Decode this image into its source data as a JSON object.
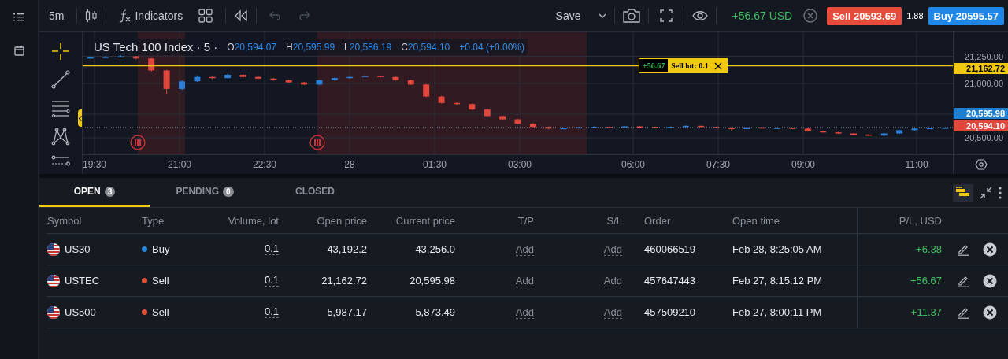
{
  "toolbar": {
    "timeframe": "5m",
    "indicators": "Indicators",
    "save": "Save",
    "pnl": "+56.67 USD",
    "sell": "Sell 20593.69",
    "spread": "1.88",
    "buy": "Buy 20595.57"
  },
  "chart": {
    "title": "US Tech 100 Index · 5 ·",
    "ohlc": [
      {
        "key": "O",
        "value": "20,594.07"
      },
      {
        "key": "H",
        "value": "20,595.99"
      },
      {
        "key": "L",
        "value": "20,586.19"
      },
      {
        "key": "C",
        "value": "20,594.10"
      }
    ],
    "change": "+0.04 (+0.00%)",
    "order_badge": {
      "pnl": "+56.67",
      "label": "Sell lot: 0.1"
    },
    "time_labels": [
      "19:30",
      "21:00",
      "22:30",
      "28",
      "01:30",
      "03:00",
      "06:00",
      "07:30",
      "09:00",
      "11:00"
    ],
    "tags": [
      {
        "kind": "order",
        "text": "21,162.72"
      },
      {
        "kind": "ask",
        "text": "20,595.98"
      },
      {
        "kind": "bid",
        "text": "20,594.10"
      }
    ],
    "chart_data": {
      "type": "candlestick",
      "categories": [
        null,
        null,
        null,
        null,
        null,
        null,
        null,
        null,
        null,
        null,
        null,
        null,
        null,
        null,
        null,
        null,
        null,
        null,
        null,
        null,
        null,
        null,
        null,
        null,
        null,
        null,
        null,
        null,
        null,
        null,
        null,
        null,
        null,
        null,
        null,
        null,
        null,
        null,
        null,
        null,
        null,
        null,
        null,
        null,
        null,
        null,
        null,
        null,
        null,
        null,
        null,
        null,
        null,
        null,
        null,
        null,
        null
      ],
      "ohlc": [
        [
          21235,
          21248,
          21230,
          21240
        ],
        [
          21240,
          21252,
          21236,
          21245
        ],
        [
          21245,
          21262,
          21240,
          21250
        ],
        [
          21250,
          21255,
          21220,
          21230
        ],
        [
          21230,
          21235,
          21110,
          21120
        ],
        [
          21120,
          21125,
          20900,
          20950
        ],
        [
          20950,
          21030,
          20940,
          21020
        ],
        [
          21020,
          21075,
          21015,
          21060
        ],
        [
          21060,
          21068,
          21040,
          21050
        ],
        [
          21050,
          21090,
          21045,
          21080
        ],
        [
          21080,
          21085,
          21055,
          21060
        ],
        [
          21060,
          21066,
          21040,
          21045
        ],
        [
          21045,
          21050,
          21025,
          21030
        ],
        [
          21030,
          21036,
          21005,
          21010
        ],
        [
          21010,
          21015,
          20985,
          20990
        ],
        [
          20990,
          21035,
          20985,
          21030
        ],
        [
          21030,
          21055,
          21025,
          21050
        ],
        [
          21050,
          21065,
          21045,
          21060
        ],
        [
          21060,
          21075,
          21055,
          21070
        ],
        [
          21070,
          21074,
          21055,
          21060
        ],
        [
          21060,
          21064,
          21025,
          21030
        ],
        [
          21030,
          21035,
          20985,
          20990
        ],
        [
          20990,
          20995,
          20875,
          20880
        ],
        [
          20880,
          20885,
          20815,
          20820
        ],
        [
          20820,
          20830,
          20800,
          20810
        ],
        [
          20810,
          20815,
          20755,
          20760
        ],
        [
          20760,
          20765,
          20695,
          20700
        ],
        [
          20700,
          20705,
          20665,
          20670
        ],
        [
          20670,
          20675,
          20625,
          20630
        ],
        [
          20630,
          20635,
          20595,
          20600
        ],
        [
          20600,
          20604,
          20578,
          20585
        ],
        [
          20585,
          20594,
          20580,
          20590
        ],
        [
          20590,
          20601,
          20586,
          20597
        ],
        [
          20597,
          20606,
          20592,
          20600
        ],
        [
          20600,
          20604,
          20594,
          20598
        ],
        [
          20598,
          20610,
          20595,
          20605
        ],
        [
          20605,
          20608,
          20596,
          20600
        ],
        [
          20600,
          20603,
          20586,
          20590
        ],
        [
          20590,
          20604,
          20587,
          20600
        ],
        [
          20600,
          20615,
          20597,
          20610
        ],
        [
          20610,
          20613,
          20596,
          20600
        ],
        [
          20600,
          20603,
          20590,
          20595
        ],
        [
          20595,
          20598,
          20560,
          20580
        ],
        [
          20580,
          20600,
          20576,
          20596
        ],
        [
          20596,
          20599,
          20585,
          20590
        ],
        [
          20590,
          20596,
          20586,
          20592
        ],
        [
          20592,
          20595,
          20580,
          20585
        ],
        [
          20585,
          20588,
          20556,
          20560
        ],
        [
          20560,
          20564,
          20546,
          20550
        ],
        [
          20550,
          20554,
          20536,
          20540
        ],
        [
          20540,
          20544,
          20526,
          20530
        ],
        [
          20530,
          20534,
          20512,
          20520
        ],
        [
          20520,
          20545,
          20516,
          20540
        ],
        [
          20540,
          20574,
          20536,
          20570
        ],
        [
          20570,
          20589,
          20566,
          20585
        ],
        [
          20585,
          20594,
          20581,
          20590
        ],
        [
          20590,
          20597,
          20586,
          20594
        ]
      ],
      "ylim": [
        20348,
        21471
      ],
      "grid": true,
      "ref_lines": [
        {
          "axis": "y",
          "value": 21162.72,
          "color": "#f2c811"
        },
        {
          "axis": "y",
          "value": 20594.1,
          "color": "#8a8fa0"
        }
      ],
      "yticks": [
        {
          "value": 21250,
          "label": "21,250.00"
        },
        {
          "value": 21000,
          "label": "21,000.00"
        },
        {
          "value": 20500,
          "label": "20,500.00"
        }
      ]
    }
  },
  "positions": {
    "tabs": [
      {
        "label": "OPEN",
        "count": "3",
        "selected": true
      },
      {
        "label": "PENDING",
        "count": "0",
        "selected": false
      },
      {
        "label": "CLOSED",
        "selected": false
      }
    ],
    "columns": [
      "Symbol",
      "Type",
      "Volume, lot",
      "Open price",
      "Current price",
      "T/P",
      "S/L",
      "Order",
      "Open time",
      "P/L, USD"
    ],
    "rows": [
      {
        "symbol": "US30",
        "type": "Buy",
        "color": "#2a86d6",
        "volume": "0.1",
        "open_price": "43,192.2",
        "current_price": "43,256.0",
        "tp": "Add",
        "sl": "Add",
        "order": "460066519",
        "open_time": "Feb 28, 8:25:05 AM",
        "pl": "+6.38"
      },
      {
        "symbol": "USTEC",
        "type": "Sell",
        "color": "#e0533a",
        "volume": "0.1",
        "open_price": "21,162.72",
        "current_price": "20,595.98",
        "tp": "Add",
        "sl": "Add",
        "order": "457647443",
        "open_time": "Feb 27, 8:15:12 PM",
        "pl": "+56.67"
      },
      {
        "symbol": "US500",
        "type": "Sell",
        "color": "#e0533a",
        "volume": "0.1",
        "open_price": "5,987.17",
        "current_price": "5,873.49",
        "tp": "Add",
        "sl": "Add",
        "order": "457509210",
        "open_time": "Feb 27, 8:00:11 PM",
        "pl": "+11.37"
      }
    ]
  }
}
